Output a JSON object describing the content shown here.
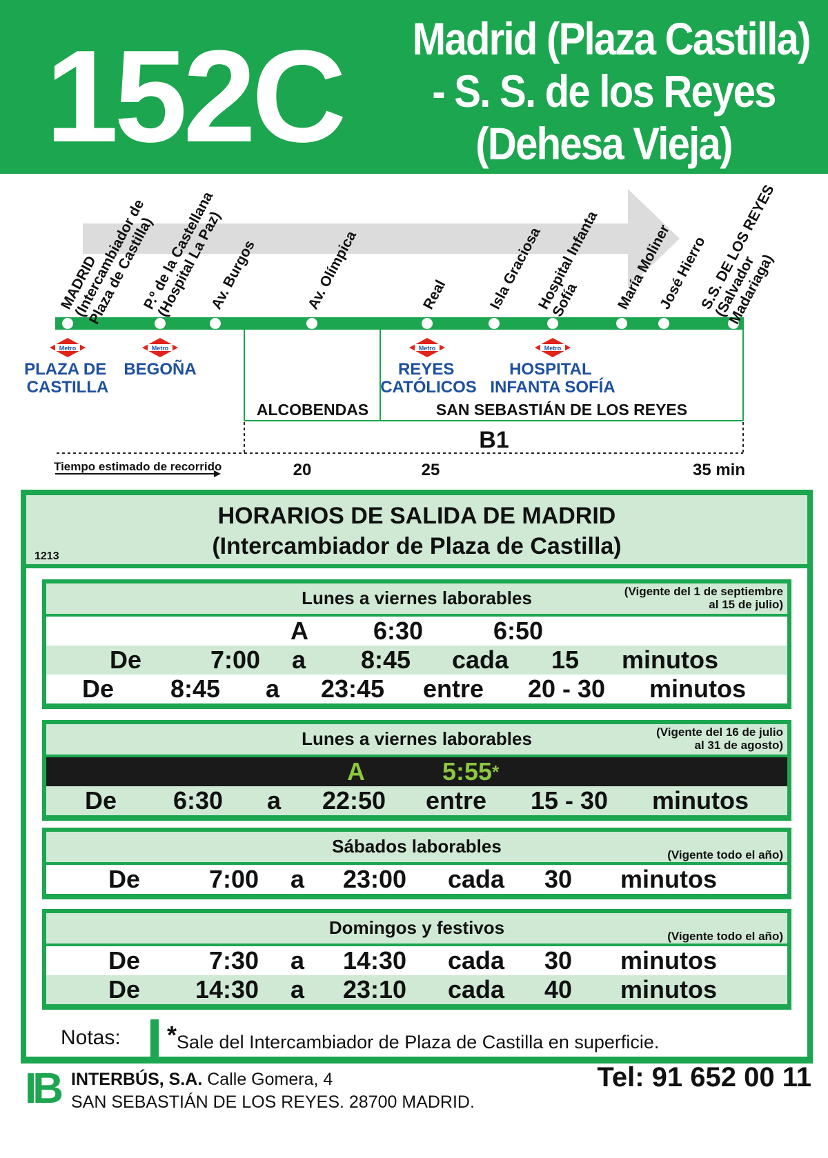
{
  "header": {
    "route_number": "152C",
    "title_line1": "Madrid (Plaza Castilla)",
    "title_line2": "- S. S. de los Reyes",
    "title_line3": "(Dehesa Vieja)",
    "color": "#1ca64f"
  },
  "map": {
    "stops": [
      [
        "MADRID",
        "(Intercambiador de",
        "Plaza de Castilla)"
      ],
      [
        "P.º de la Castellana",
        "(Hospital La Paz)"
      ],
      [
        "Av. Burgos"
      ],
      [
        "Av. Olímpica"
      ],
      [
        "Real"
      ],
      [
        "Isla Graciosa"
      ],
      [
        "Hospital Infanta",
        "Sofía"
      ],
      [
        "María Moliner"
      ],
      [
        "José Hierro"
      ],
      [
        "S.S. DE LOS REYES",
        "(Salvador",
        "Madariaga)"
      ]
    ],
    "metro_icon_text": "Metro",
    "metro_stations": [
      [
        "PLAZA DE",
        "CASTILLA"
      ],
      [
        "BEGOÑA"
      ],
      [
        "REYES",
        "CATÓLICOS"
      ],
      [
        "HOSPITAL",
        "INFANTA SOFÍA"
      ]
    ],
    "zones": [
      "ALCOBENDAS",
      "SAN SEBASTIÁN DE LOS REYES"
    ],
    "fare_zone": "B1",
    "time_label": "Tiempo estimado de recorrido",
    "times": [
      "20",
      "25",
      "35 min"
    ]
  },
  "schedule": {
    "title_line1": "HORARIOS DE SALIDA DE MADRID",
    "title_line2": "(Intercambiador de Plaza de Castilla)",
    "code": "1213",
    "blocks": [
      {
        "title": "Lunes a viernes laborables",
        "validity1": "(Vigente del 1 de septiembre",
        "validity2": "al 15 de julio)",
        "row1": {
          "a": "A",
          "t1": "6:30",
          "t2": "6:50"
        },
        "row2": {
          "de": "De",
          "from": "7:00",
          "a": "a",
          "to": "8:45",
          "mode": "cada",
          "freq": "15",
          "unit": "minutos"
        },
        "row3": {
          "de": "De",
          "from": "8:45",
          "a": "a",
          "to": "23:45",
          "mode": "entre",
          "freq": "20 - 30",
          "unit": "minutos"
        }
      },
      {
        "title": "Lunes a viernes laborables",
        "validity1": "(Vigente del 16 de julio",
        "validity2": "al 31 de agosto)",
        "row1": {
          "a": "A",
          "t1": "5:55",
          "star": "*"
        },
        "row2": {
          "de": "De",
          "from": "6:30",
          "a": "a",
          "to": "22:50",
          "mode": "entre",
          "freq": "15 - 30",
          "unit": "minutos"
        }
      },
      {
        "title": "Sábados laborables",
        "validity1": "(Vigente todo el año)",
        "row1": {
          "de": "De",
          "from": "7:00",
          "a": "a",
          "to": "23:00",
          "mode": "cada",
          "freq": "30",
          "unit": "minutos"
        }
      },
      {
        "title": "Domingos y festivos",
        "validity1": "(Vigente todo el año)",
        "row1": {
          "de": "De",
          "from": "7:30",
          "a": "a",
          "to": "14:30",
          "mode": "cada",
          "freq": "30",
          "unit": "minutos"
        },
        "row2": {
          "de": "De",
          "from": "14:30",
          "a": "a",
          "to": "23:10",
          "mode": "cada",
          "freq": "40",
          "unit": "minutos"
        }
      }
    ],
    "notes_label": "Notas:",
    "notes_star": "*",
    "notes_text": "Sale del Intercambiador de Plaza de Castilla en superficie."
  },
  "footer": {
    "logo": "IB",
    "company": "INTERBÚS, S.A.",
    "address": "Calle Gomera, 4",
    "city": "SAN SEBASTIÁN DE LOS REYES. 28700 MADRID.",
    "phone": "Tel: 91 652 00 11"
  }
}
